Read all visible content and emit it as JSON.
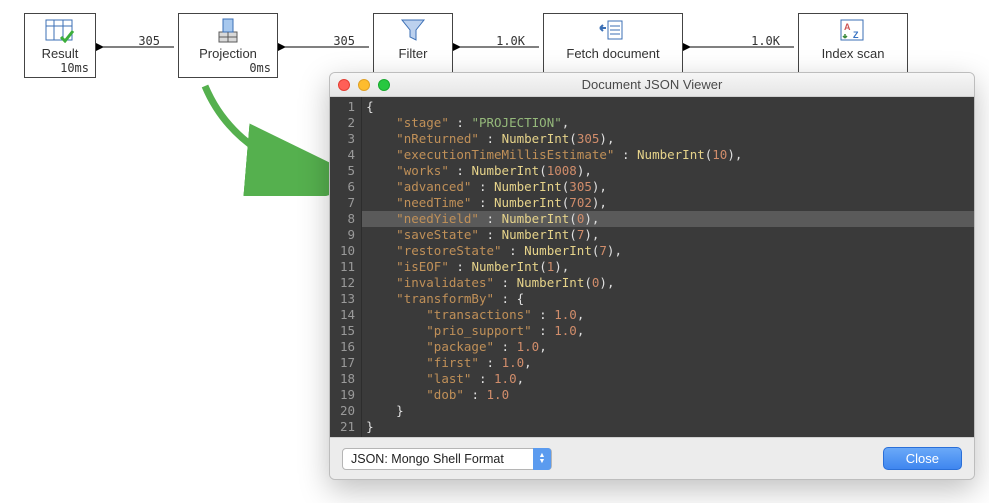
{
  "pipeline": {
    "stages": [
      {
        "label": "Result",
        "timing": "10ms"
      },
      {
        "label": "Projection",
        "timing": "0ms"
      },
      {
        "label": "Filter",
        "timing": ""
      },
      {
        "label": "Fetch document",
        "timing": ""
      },
      {
        "label": "Index scan",
        "timing": ""
      }
    ],
    "connectors": [
      "305",
      "305",
      "1.0K",
      "1.0K"
    ]
  },
  "dialog": {
    "title": "Document JSON Viewer",
    "format_select": "JSON: Mongo Shell Format",
    "close_btn": "Close",
    "highlighted_line": 8,
    "code": [
      "{",
      "    \"stage\" : \"PROJECTION\",",
      "    \"nReturned\" : NumberInt(305),",
      "    \"executionTimeMillisEstimate\" : NumberInt(10),",
      "    \"works\" : NumberInt(1008),",
      "    \"advanced\" : NumberInt(305),",
      "    \"needTime\" : NumberInt(702),",
      "    \"needYield\" : NumberInt(0),",
      "    \"saveState\" : NumberInt(7),",
      "    \"restoreState\" : NumberInt(7),",
      "    \"isEOF\" : NumberInt(1),",
      "    \"invalidates\" : NumberInt(0),",
      "    \"transformBy\" : {",
      "        \"transactions\" : 1.0,",
      "        \"prio_support\" : 1.0,",
      "        \"package\" : 1.0,",
      "        \"first\" : 1.0,",
      "        \"last\" : 1.0,",
      "        \"dob\" : 1.0",
      "    }",
      "}"
    ]
  }
}
